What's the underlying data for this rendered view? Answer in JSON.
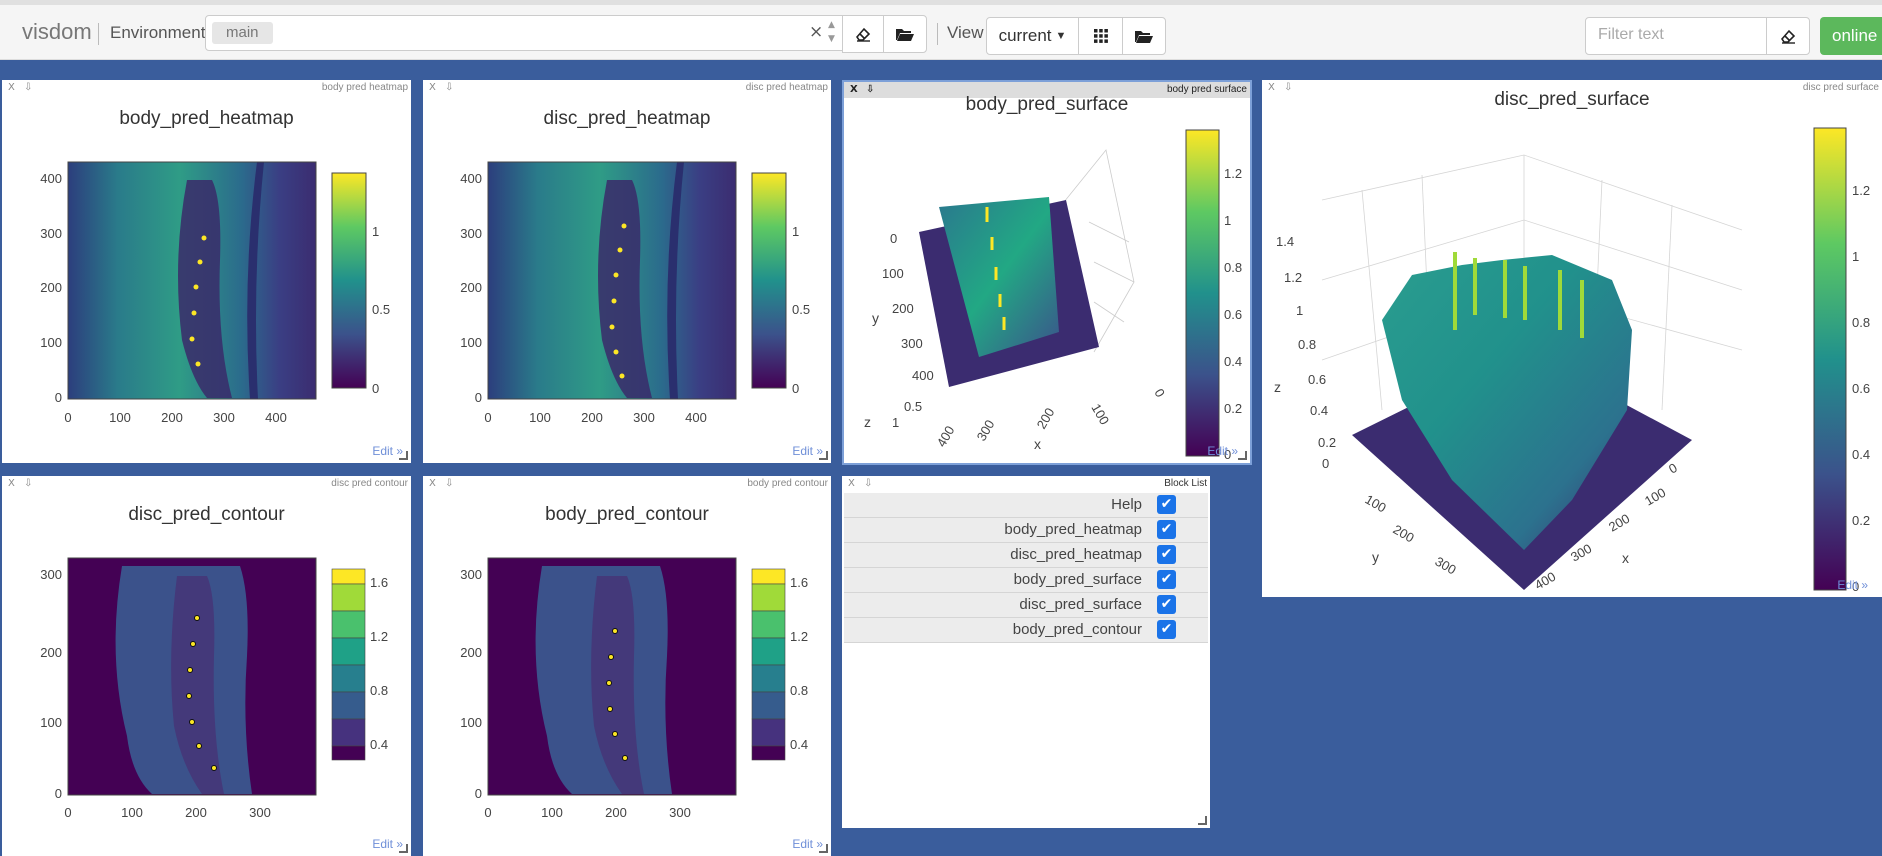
{
  "app": {
    "logo": "visdom",
    "env_label": "Environment",
    "env_value": "main",
    "view_label": "View",
    "view_value": "current",
    "filter_placeholder": "Filter text",
    "online_label": "online"
  },
  "icons": {
    "clear_env": "eraser-icon",
    "open_env": "folder-open-icon",
    "grid": "grid-icon",
    "open_view": "folder-open-icon",
    "clear_filter": "eraser-icon"
  },
  "colors": {
    "background": "#3a5d9c",
    "online": "#5cb85c",
    "checkbox": "#1a73e8",
    "viridis_dark": "#440154",
    "viridis_teal": "#21918c",
    "viridis_yellow": "#fde725"
  },
  "panes": {
    "body_heatmap": {
      "close": "X",
      "download": "⇩",
      "name": "body pred heatmap",
      "title": "body_pred_heatmap",
      "edit": "Edit »",
      "yticks": [
        "400",
        "300",
        "200",
        "100",
        "0"
      ],
      "xticks": [
        "0",
        "100",
        "200",
        "300",
        "400"
      ],
      "cbar_ticks": [
        "1",
        "0.5",
        "0"
      ]
    },
    "disc_heatmap": {
      "close": "X",
      "download": "⇩",
      "name": "disc pred heatmap",
      "title": "disc_pred_heatmap",
      "edit": "Edit »",
      "yticks": [
        "400",
        "300",
        "200",
        "100",
        "0"
      ],
      "xticks": [
        "0",
        "100",
        "200",
        "300",
        "400"
      ],
      "cbar_ticks": [
        "1",
        "0.5",
        "0"
      ]
    },
    "body_surface": {
      "close": "X",
      "download": "⇩",
      "name": "body pred surface",
      "title": "body_pred_surface",
      "edit": "Edit »",
      "y_axis_label": "y",
      "x_axis_label": "x",
      "z_axis_label": "z",
      "yticks": [
        "0",
        "100",
        "200",
        "300",
        "400"
      ],
      "xticks": [
        "400",
        "300",
        "200",
        "100",
        "0"
      ],
      "zticks": [
        "0.5",
        "1"
      ],
      "cbar_ticks": [
        "1.2",
        "1",
        "0.8",
        "0.6",
        "0.4",
        "0.2",
        "0"
      ]
    },
    "disc_surface": {
      "close": "X",
      "download": "⇩",
      "name": "disc pred surface",
      "title": "disc_pred_surface",
      "edit": "Edit »",
      "y_axis_label": "y",
      "x_axis_label": "x",
      "z_axis_label": "z",
      "zticks": [
        "1.4",
        "1.2",
        "1",
        "0.8",
        "0.6",
        "0.4",
        "0.2",
        "0"
      ],
      "yticks": [
        "100",
        "200",
        "300"
      ],
      "xticks": [
        "0",
        "100",
        "200",
        "300",
        "400"
      ],
      "cbar_ticks": [
        "1.2",
        "1",
        "0.8",
        "0.6",
        "0.4",
        "0.2",
        "0"
      ]
    },
    "disc_contour": {
      "close": "X",
      "download": "⇩",
      "name": "disc pred contour",
      "title": "disc_pred_contour",
      "edit": "Edit »",
      "yticks": [
        "300",
        "200",
        "100",
        "0"
      ],
      "xticks": [
        "0",
        "100",
        "200",
        "300"
      ],
      "cbar_ticks": [
        "1.6",
        "1.2",
        "0.8",
        "0.4"
      ]
    },
    "body_contour": {
      "close": "X",
      "download": "⇩",
      "name": "body pred contour",
      "title": "body_pred_contour",
      "edit": "Edit »",
      "yticks": [
        "300",
        "200",
        "100",
        "0"
      ],
      "xticks": [
        "0",
        "100",
        "200",
        "300"
      ],
      "cbar_ticks": [
        "1.6",
        "1.2",
        "0.8",
        "0.4"
      ]
    },
    "block_list": {
      "close": "X",
      "download": "⇩",
      "name": "Block List",
      "items": [
        {
          "label": "Help",
          "checked": true
        },
        {
          "label": "body_pred_heatmap",
          "checked": true
        },
        {
          "label": "disc_pred_heatmap",
          "checked": true
        },
        {
          "label": "body_pred_surface",
          "checked": true
        },
        {
          "label": "disc_pred_surface",
          "checked": true
        },
        {
          "label": "body_pred_contour",
          "checked": true
        }
      ]
    }
  }
}
